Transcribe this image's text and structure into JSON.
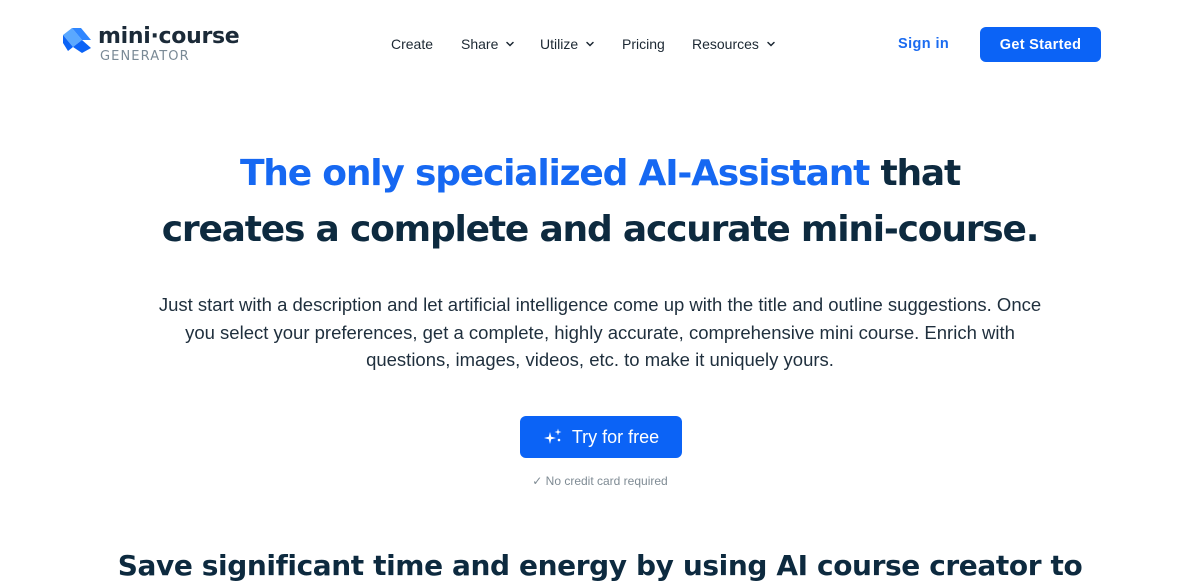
{
  "brand": {
    "name_part1": "mini",
    "name_dot": "·",
    "name_part2": "course",
    "subtitle": "GENERATOR",
    "icon": "logo-mark",
    "colors": {
      "light": "#5aa8ff",
      "dark": "#0b63f6"
    }
  },
  "nav": {
    "items": [
      {
        "label": "Create",
        "dropdown": false
      },
      {
        "label": "Share",
        "dropdown": true,
        "icon": "chevron-down-icon"
      },
      {
        "label": "Utilize",
        "dropdown": true,
        "icon": "chevron-down-icon"
      },
      {
        "label": "Pricing",
        "dropdown": false
      },
      {
        "label": "Resources",
        "dropdown": true,
        "icon": "chevron-down-icon"
      }
    ],
    "sign_in": "Sign in",
    "get_started": "Get Started"
  },
  "hero": {
    "title_highlight": "The only specialized AI-Assistant",
    "title_rest": " that",
    "title_line2": "creates a complete and accurate mini-course.",
    "description": "Just start with a description and let artificial intelligence come up with the title and outline suggestions. Once you select your preferences, get a complete, highly accurate, comprehensive mini course. Enrich with questions, images, videos, etc. to make it uniquely yours.",
    "cta_label": "Try for free",
    "cta_icon": "sparkle-icon",
    "note": "✓ No credit card required"
  },
  "section": {
    "title": "Save significant time and energy by using AI course creator to"
  },
  "colors": {
    "accent": "#0b63f6",
    "highlight_text": "#1668f2",
    "heading": "#0d2a3f",
    "muted": "#7f8b94"
  }
}
